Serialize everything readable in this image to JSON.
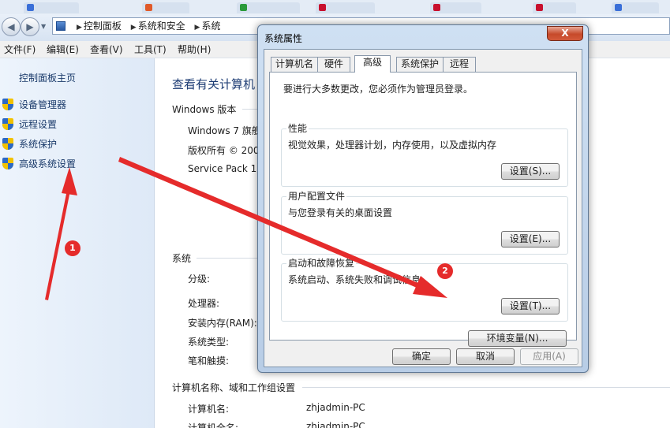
{
  "address_bar": {
    "crumbs": [
      "控制面板",
      "系统和安全",
      "系统"
    ]
  },
  "menu": [
    "文件(F)",
    "编辑(E)",
    "查看(V)",
    "工具(T)",
    "帮助(H)"
  ],
  "sidebar": {
    "home": "控制面板主页",
    "items": [
      "设备管理器",
      "远程设置",
      "系统保护",
      "高级系统设置"
    ]
  },
  "content": {
    "title": "查看有关计算机",
    "windows_edition_heading": "Windows 版本",
    "edition": "Windows 7 旗舰",
    "copyright": "版权所有 © 200",
    "service_pack": "Service Pack 1",
    "system_heading": "系统",
    "rating_label": "分级:",
    "processor_label": "处理器:",
    "memory_label": "安装内存(RAM):",
    "system_type_label": "系统类型:",
    "pen_touch_label": "笔和触摸:",
    "computer_heading": "计算机名称、域和工作组设置",
    "computer_name_label": "计算机名:",
    "computer_name_value": "zhjadmin-PC",
    "full_name_label": "计算机全名:",
    "full_name_value": "zhjadmin-PC"
  },
  "dialog": {
    "title": "系统属性",
    "close_label": "X",
    "tabs": [
      "计算机名",
      "硬件",
      "高级",
      "系统保护",
      "远程"
    ],
    "admin_note": "要进行大多数更改，您必须作为管理员登录。",
    "performance": {
      "title": "性能",
      "desc": "视觉效果，处理器计划，内存使用，以及虚拟内存",
      "button": "设置(S)..."
    },
    "user_profiles": {
      "title": "用户配置文件",
      "desc": "与您登录有关的桌面设置",
      "button": "设置(E)..."
    },
    "startup_recovery": {
      "title": "启动和故障恢复",
      "desc": "系统启动、系统失败和调试信息",
      "button": "设置(T)..."
    },
    "env_vars_button": "环境变量(N)...",
    "ok": "确定",
    "cancel": "取消",
    "apply": "应用(A)"
  },
  "annotations": {
    "badge1": "1",
    "badge2": "2",
    "color": "#e52b2b"
  }
}
